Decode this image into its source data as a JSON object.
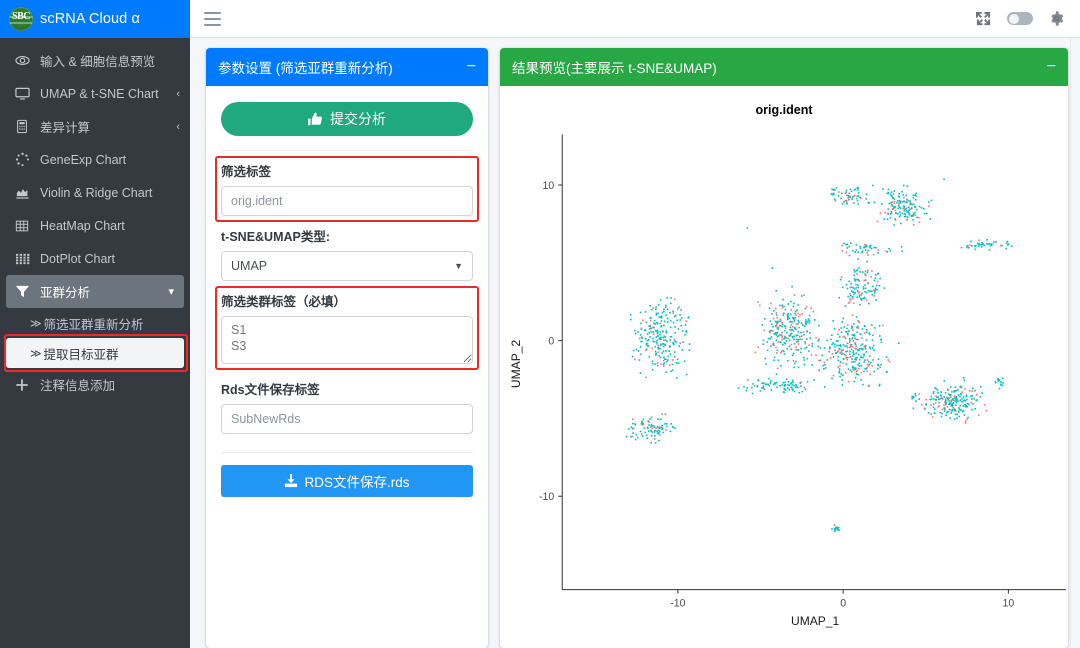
{
  "brand": {
    "logo_text": "SBC",
    "logo_icon": "globe-logo-icon",
    "title": "scRNA Cloud α"
  },
  "topbar": {
    "menu_icon": "hamburger-icon",
    "expand_icon": "fullscreen-expand-icon",
    "theme_toggle": "dark-mode-toggle",
    "settings_icon": "gear-icon"
  },
  "sidebar": {
    "items": [
      {
        "label": "输入 & 细胞信息预览",
        "icon": "eye-icon",
        "caret": ""
      },
      {
        "label": "UMAP & t-SNE Chart",
        "icon": "monitor-icon",
        "caret": "‹"
      },
      {
        "label": "差异计算",
        "icon": "calculator-icon",
        "caret": "‹"
      },
      {
        "label": "GeneExp Chart",
        "icon": "spinner-dots-icon",
        "caret": ""
      },
      {
        "label": "Violin & Ridge Chart",
        "icon": "area-chart-icon",
        "caret": ""
      },
      {
        "label": "HeatMap Chart",
        "icon": "grid-table-icon",
        "caret": ""
      },
      {
        "label": "DotPlot Chart",
        "icon": "dot-matrix-icon",
        "caret": ""
      },
      {
        "label": "亚群分析",
        "icon": "funnel-filter-icon",
        "caret": "˅",
        "active": true
      },
      {
        "label": "注释信息添加",
        "icon": "plus-icon",
        "caret": ""
      }
    ],
    "subitems": [
      {
        "label": "筛选亚群重新分析",
        "chevron": "≫",
        "selected": false
      },
      {
        "label": "提取目标亚群",
        "chevron": "≫",
        "selected": true
      }
    ]
  },
  "params_panel": {
    "title": "参数设置 (筛选亚群重新分析)",
    "collapse_icon": "−",
    "submit_label": "提交分析",
    "submit_icon": "thumbs-up-icon",
    "filter_label_title": "筛选标签",
    "filter_label_value": "orig.ident",
    "chart_type_title": "t-SNE&UMAP类型:",
    "chart_type_value": "UMAP",
    "cluster_label_title": "筛选类群标签（必填）",
    "cluster_label_value": "S1\nS3",
    "rds_label_title": "Rds文件保存标签",
    "rds_label_value": "SubNewRds",
    "save_label": "RDS文件保存.rds",
    "save_icon": "download-icon",
    "highlight_color": "#ef2828"
  },
  "results_panel": {
    "title": "结果预览(主要展示 t-SNE&UMAP)",
    "collapse_icon": "−"
  },
  "chart_data": {
    "type": "scatter",
    "title": "orig.ident",
    "xlabel": "UMAP_1",
    "ylabel": "UMAP_2",
    "xlim": [
      -17,
      13
    ],
    "ylim": [
      -16,
      13
    ],
    "xticks": [
      -10,
      0,
      10
    ],
    "yticks": [
      -10,
      0,
      10
    ],
    "grid": false,
    "legend": "none",
    "point_size": 1.6,
    "series": [
      {
        "name": "S1",
        "color": "#00bfc4"
      },
      {
        "name": "S3",
        "color": "#f8766d"
      }
    ],
    "clusters": [
      {
        "cx": -11.0,
        "cy": 0.2,
        "rx": 1.7,
        "ry": 2.6,
        "n": 230,
        "teal_frac": 0.8
      },
      {
        "cx": -11.6,
        "cy": -5.7,
        "rx": 1.5,
        "ry": 0.9,
        "n": 90,
        "teal_frac": 0.84
      },
      {
        "cx": -3.2,
        "cy": 0.6,
        "rx": 1.9,
        "ry": 2.5,
        "n": 250,
        "teal_frac": 0.76
      },
      {
        "cx": 0.6,
        "cy": -0.6,
        "rx": 2.2,
        "ry": 2.4,
        "n": 270,
        "teal_frac": 0.76
      },
      {
        "cx": 1.2,
        "cy": 3.6,
        "rx": 1.3,
        "ry": 1.5,
        "n": 110,
        "teal_frac": 0.78
      },
      {
        "cx": 3.5,
        "cy": 8.6,
        "rx": 1.5,
        "ry": 1.3,
        "n": 150,
        "teal_frac": 0.76
      },
      {
        "cx": 0.3,
        "cy": 9.4,
        "rx": 1.2,
        "ry": 0.7,
        "n": 60,
        "teal_frac": 0.8
      },
      {
        "cx": 6.6,
        "cy": -3.9,
        "rx": 2.1,
        "ry": 1.3,
        "n": 200,
        "teal_frac": 0.78
      },
      {
        "cx": -3.9,
        "cy": -2.9,
        "rx": 2.6,
        "ry": 0.5,
        "n": 80,
        "teal_frac": 0.86
      },
      {
        "cx": 1.4,
        "cy": 5.9,
        "rx": 1.9,
        "ry": 0.5,
        "n": 45,
        "teal_frac": 0.88
      },
      {
        "cx": 8.6,
        "cy": 6.2,
        "rx": 1.9,
        "ry": 0.4,
        "n": 40,
        "teal_frac": 0.92
      },
      {
        "cx": -0.4,
        "cy": -12.0,
        "rx": 0.3,
        "ry": 0.5,
        "n": 14,
        "teal_frac": 0.95
      },
      {
        "cx": 9.4,
        "cy": -2.6,
        "rx": 0.6,
        "ry": 0.5,
        "n": 14,
        "teal_frac": 0.95
      },
      {
        "cx": 4.3,
        "cy": -3.6,
        "rx": 0.4,
        "ry": 0.2,
        "n": 8,
        "teal_frac": 0.95
      },
      {
        "cx": -5.8,
        "cy": 7.3,
        "rx": 0.12,
        "ry": 0.12,
        "n": 1,
        "teal_frac": 1.0
      },
      {
        "cx": -4.2,
        "cy": 4.6,
        "rx": 0.12,
        "ry": 0.12,
        "n": 1,
        "teal_frac": 1.0
      },
      {
        "cx": 6.1,
        "cy": 10.3,
        "rx": 0.12,
        "ry": 0.12,
        "n": 1,
        "teal_frac": 1.0
      },
      {
        "cx": 1.9,
        "cy": 9.9,
        "rx": 0.12,
        "ry": 0.12,
        "n": 1,
        "teal_frac": 1.0
      }
    ]
  }
}
